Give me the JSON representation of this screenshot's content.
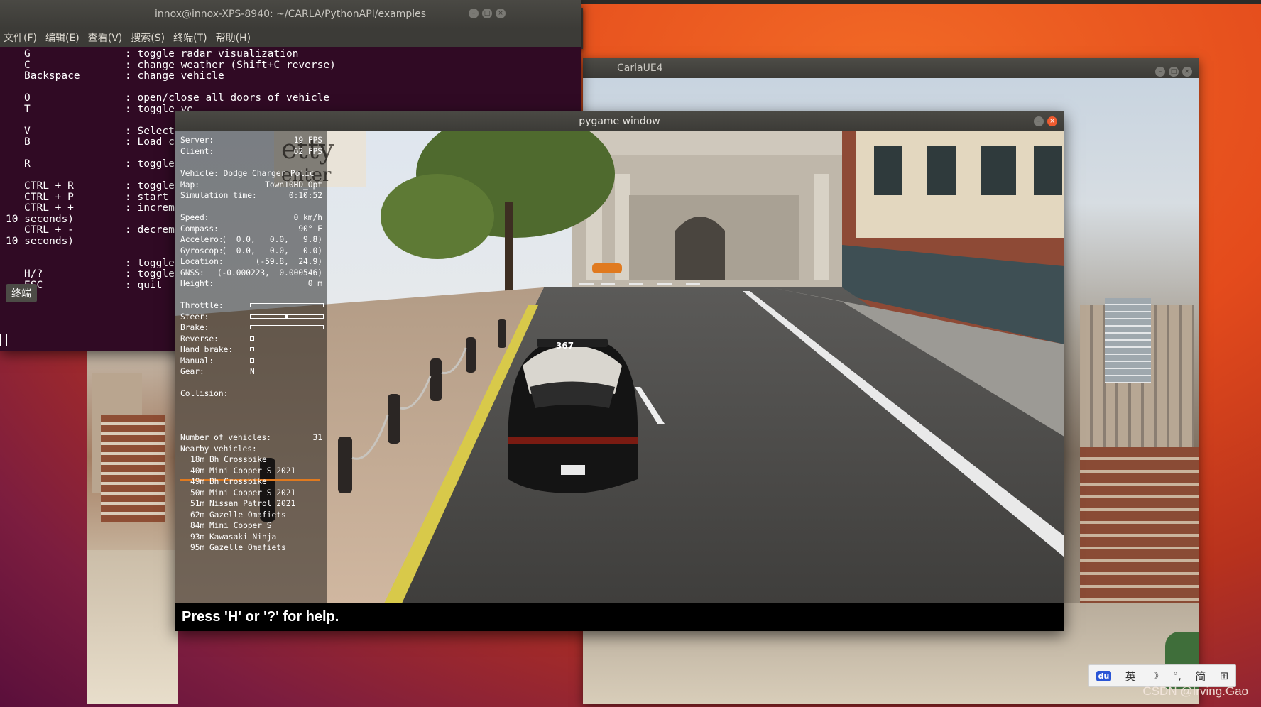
{
  "terminal": {
    "title": "innox@innox-XPS-8940: ~/CARLA/PythonAPI/examples",
    "menu": [
      "文件(F)",
      "编辑(E)",
      "查看(V)",
      "搜索(S)",
      "终端(T)",
      "帮助(H)"
    ],
    "tab_label": "终端",
    "lines": [
      {
        "key": "G",
        "desc": ": toggle radar visualization"
      },
      {
        "key": "C",
        "desc": ": change weather (Shift+C reverse)"
      },
      {
        "key": "Backspace",
        "desc": ": change vehicle"
      },
      {
        "key": "",
        "desc": ""
      },
      {
        "key": "O",
        "desc": ": open/close all doors of vehicle"
      },
      {
        "key": "T",
        "desc": ": toggle ve"
      },
      {
        "key": "",
        "desc": ""
      },
      {
        "key": "V",
        "desc": ": Select ne"
      },
      {
        "key": "B",
        "desc": ": Load curr"
      },
      {
        "key": "",
        "desc": ""
      },
      {
        "key": "R",
        "desc": ": toggle re"
      },
      {
        "key": "",
        "desc": ""
      },
      {
        "key": "CTRL + R",
        "desc": ": toggle re"
      },
      {
        "key": "CTRL + P",
        "desc": ": start rep"
      },
      {
        "key": "CTRL + +",
        "desc": ": increment"
      },
      {
        "key": "10 seconds)",
        "desc": "",
        "wrap": true
      },
      {
        "key": "CTRL + -",
        "desc": ": decrement"
      },
      {
        "key": "10 seconds)",
        "desc": "",
        "wrap": true
      },
      {
        "key": "",
        "desc": ""
      },
      {
        "key": "",
        "desc": ": toggle HU"
      },
      {
        "key": "H/?",
        "desc": ": toggle he"
      },
      {
        "key": "ESC",
        "desc": ": quit"
      }
    ]
  },
  "carla_window": {
    "title": "CarlaUE4"
  },
  "pygame_window": {
    "title": "pygame window",
    "help_text": "Press 'H' or '?' for help."
  },
  "hud": {
    "server_label": "Server:",
    "server_value": "19 FPS",
    "client_label": "Client:",
    "client_value": "62 FPS",
    "vehicle": "Vehicle: Dodge Charger Polic",
    "map_label": "Map:",
    "map_value": "Town10HD_Opt",
    "sim_time_label": "Simulation time:",
    "sim_time_value": "0:10:52",
    "speed_label": "Speed:",
    "speed_value": "0 km/h",
    "compass_label": "Compass:",
    "compass_value": "90° E",
    "accelero_label": "Accelero:",
    "accelero_value": "(  0.0,   0.0,   9.8)",
    "gyroscop_label": "Gyroscop:",
    "gyroscop_value": "(  0.0,   0.0,   0.0)",
    "location_label": "Location:",
    "location_value": "(-59.8,  24.9)",
    "gnss_label": "GNSS:",
    "gnss_value": "(-0.000223,  0.000546)",
    "height_label": "Height:",
    "height_value": "0 m",
    "throttle_label": "Throttle:",
    "throttle": 0.0,
    "steer_label": "Steer:",
    "steer": 0.0,
    "brake_label": "Brake:",
    "brake": 0.0,
    "reverse_label": "Reverse:",
    "hand_brake_label": "Hand brake:",
    "manual_label": "Manual:",
    "gear_label": "Gear:",
    "gear_value": "N",
    "collision_label": "Collision:",
    "num_vehicles_label": "Number of vehicles:",
    "num_vehicles_value": "31",
    "nearby_label": "Nearby vehicles:",
    "nearby": [
      "18m Bh Crossbike",
      "40m Mini Cooper S 2021",
      "49m Bh Crossbike",
      "50m Mini Cooper S 2021",
      "51m Nissan Patrol 2021",
      "62m Gazelle Omafiets",
      "84m Mini Cooper S",
      "93m Kawasaki Ninja",
      "95m Gazelle Omafiets"
    ]
  },
  "scene": {
    "banner_text": "etty\nenter",
    "car_number": "367"
  },
  "ime": {
    "logo": "du",
    "items": [
      "英",
      "☽",
      "°,",
      "简",
      "⊞"
    ]
  },
  "watermark": "CSDN @Irving.Gao"
}
